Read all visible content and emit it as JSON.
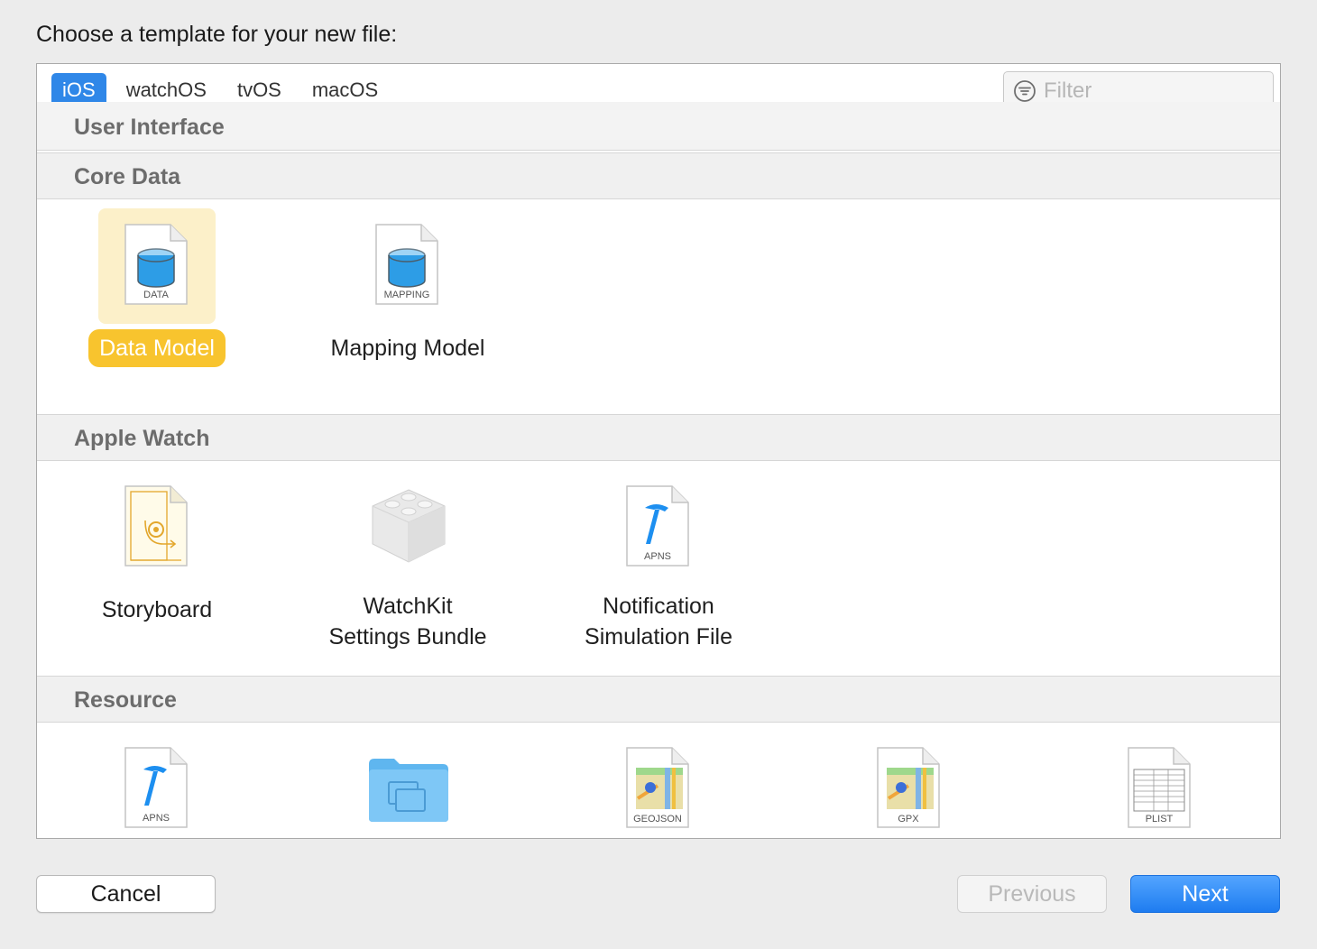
{
  "dialog": {
    "heading": "Choose a template for your new file:"
  },
  "platform_tabs": [
    {
      "label": "iOS",
      "active": true
    },
    {
      "label": "watchOS",
      "active": false
    },
    {
      "label": "tvOS",
      "active": false
    },
    {
      "label": "macOS",
      "active": false
    }
  ],
  "filter": {
    "placeholder": "Filter",
    "icon": "filter-icon"
  },
  "sections": {
    "user_interface": {
      "title": "User Interface"
    },
    "core_data": {
      "title": "Core Data",
      "items": [
        {
          "label": "Data Model",
          "badge": "DATA",
          "icon": "data-model-icon",
          "selected": true
        },
        {
          "label": "Mapping Model",
          "badge": "MAPPING",
          "icon": "mapping-model-icon",
          "selected": false
        }
      ]
    },
    "apple_watch": {
      "title": "Apple Watch",
      "items": [
        {
          "label": "Storyboard",
          "icon": "storyboard-icon"
        },
        {
          "label_line1": "WatchKit",
          "label_line2": "Settings Bundle",
          "icon": "settings-bundle-icon"
        },
        {
          "label_line1": "Notification",
          "label_line2": "Simulation File",
          "badge": "APNS",
          "icon": "apns-icon"
        }
      ]
    },
    "resource": {
      "title": "Resource",
      "items": [
        {
          "badge": "APNS",
          "icon": "apns-icon"
        },
        {
          "icon": "folder-icon"
        },
        {
          "badge": "GEOJSON",
          "icon": "map-document-icon"
        },
        {
          "badge": "GPX",
          "icon": "map-document-icon"
        },
        {
          "badge": "PLIST",
          "icon": "plist-document-icon"
        }
      ]
    }
  },
  "buttons": {
    "cancel": "Cancel",
    "previous": "Previous",
    "next": "Next"
  },
  "colors": {
    "accent": "#2f87e8",
    "selection_label": "#f8c42e",
    "selection_background": "#fcf0c9",
    "section_header_text": "#6c6c6c"
  }
}
